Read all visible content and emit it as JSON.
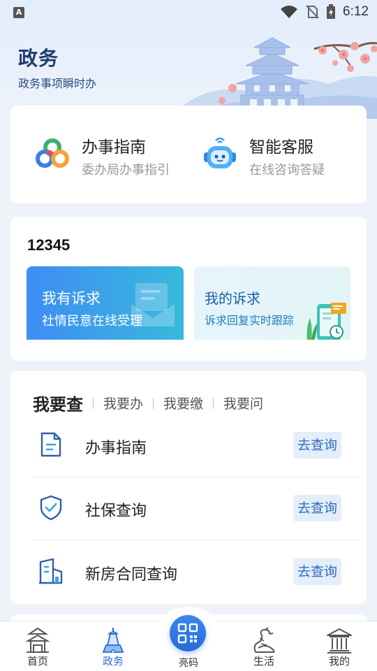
{
  "status_bar": {
    "time": "6:12",
    "indicator": "A"
  },
  "header": {
    "title": "政务",
    "subtitle": "政务事项瞬时办"
  },
  "services": [
    {
      "title": "办事指南",
      "desc": "委办局办事指引",
      "icon": "rings-logo-icon"
    },
    {
      "title": "智能客服",
      "desc": "在线咨询答疑",
      "icon": "robot-icon"
    }
  ],
  "hotline": {
    "title": "12345",
    "tiles": [
      {
        "title": "我有诉求",
        "desc": "社情民意在线受理"
      },
      {
        "title": "我的诉求",
        "desc": "诉求回复实时跟踪"
      }
    ]
  },
  "query": {
    "tabs": [
      "我要查",
      "我要办",
      "我要缴",
      "我要问"
    ],
    "items": [
      {
        "label": "办事指南",
        "button": "去查询",
        "icon": "document-icon"
      },
      {
        "label": "社保查询",
        "button": "去查询",
        "icon": "shield-check-icon"
      },
      {
        "label": "新房合同查询",
        "button": "去查询",
        "icon": "building-icon"
      }
    ]
  },
  "tabbar": {
    "items": [
      {
        "label": "首页",
        "icon": "pavilion-icon"
      },
      {
        "label": "政务",
        "icon": "tower-icon"
      },
      {
        "label": "亮码",
        "icon": "qr-code-icon"
      },
      {
        "label": "生活",
        "icon": "dragon-icon"
      },
      {
        "label": "我的",
        "icon": "temple-icon"
      }
    ],
    "active": "政务"
  },
  "colors": {
    "accent": "#2a6bd6",
    "title": "#1f3c6e",
    "button_bg": "#e4eefb"
  }
}
